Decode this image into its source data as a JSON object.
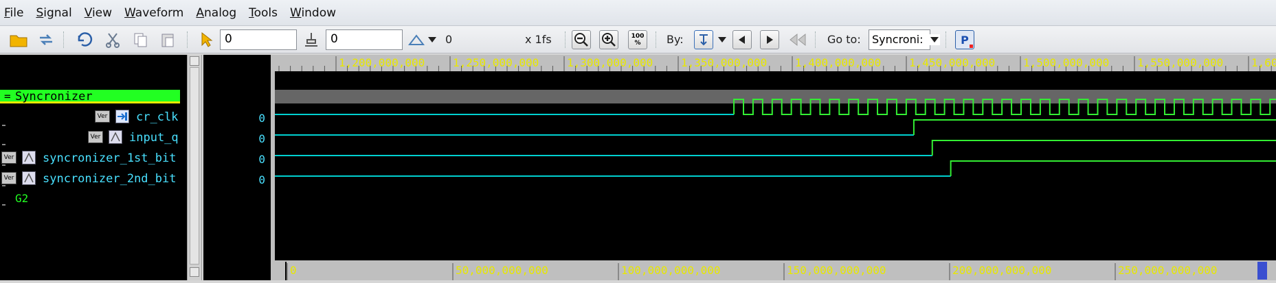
{
  "menu": [
    "File",
    "Signal",
    "View",
    "Waveform",
    "Analog",
    "Tools",
    "Window"
  ],
  "toolbar": {
    "time_field": "0",
    "cursor_field": "0",
    "delta_value": "0",
    "scale_label": "x 1fs",
    "zoom_full_label": "100\n%",
    "by_label": "By:",
    "goto_label": "Go to:",
    "goto_value": "Syncroni:",
    "p_label": "P"
  },
  "signals": {
    "group": "Syncronizer",
    "items": [
      {
        "name": "cr_clk",
        "value": "0"
      },
      {
        "name": "input_q",
        "value": "0"
      },
      {
        "name": "syncronizer_1st_bit",
        "value": "0"
      },
      {
        "name": "syncronizer_2nd_bit",
        "value": "0"
      }
    ],
    "group2": "G2",
    "badge": "Ver"
  },
  "ruler_top": [
    "1,200,000,000",
    "1,250,000,000",
    "1,300,000,000",
    "1,350,000,000",
    "1,400,000,000",
    "1,450,000,000",
    "1,500,000,000",
    "1,550,000,000",
    "1,60"
  ],
  "ruler_bottom": [
    "0",
    "50,000,000,000",
    "100,000,000,000",
    "150,000,000,000",
    "200,000,000,000",
    "250,000,000,000"
  ],
  "waves": {
    "clk_start": 1372000000,
    "clk_period": 8300000,
    "input_q_rise": 1450000000,
    "bit1_rise": 1458000000,
    "bit2_rise": 1466000000,
    "view_start": 1173000000,
    "view_end": 1607000000
  },
  "colors": {
    "wave_low": "#00d0d0",
    "wave_high": "#33ee33",
    "ruler_text": "#e8e800",
    "group_bg": "#22ff22"
  }
}
